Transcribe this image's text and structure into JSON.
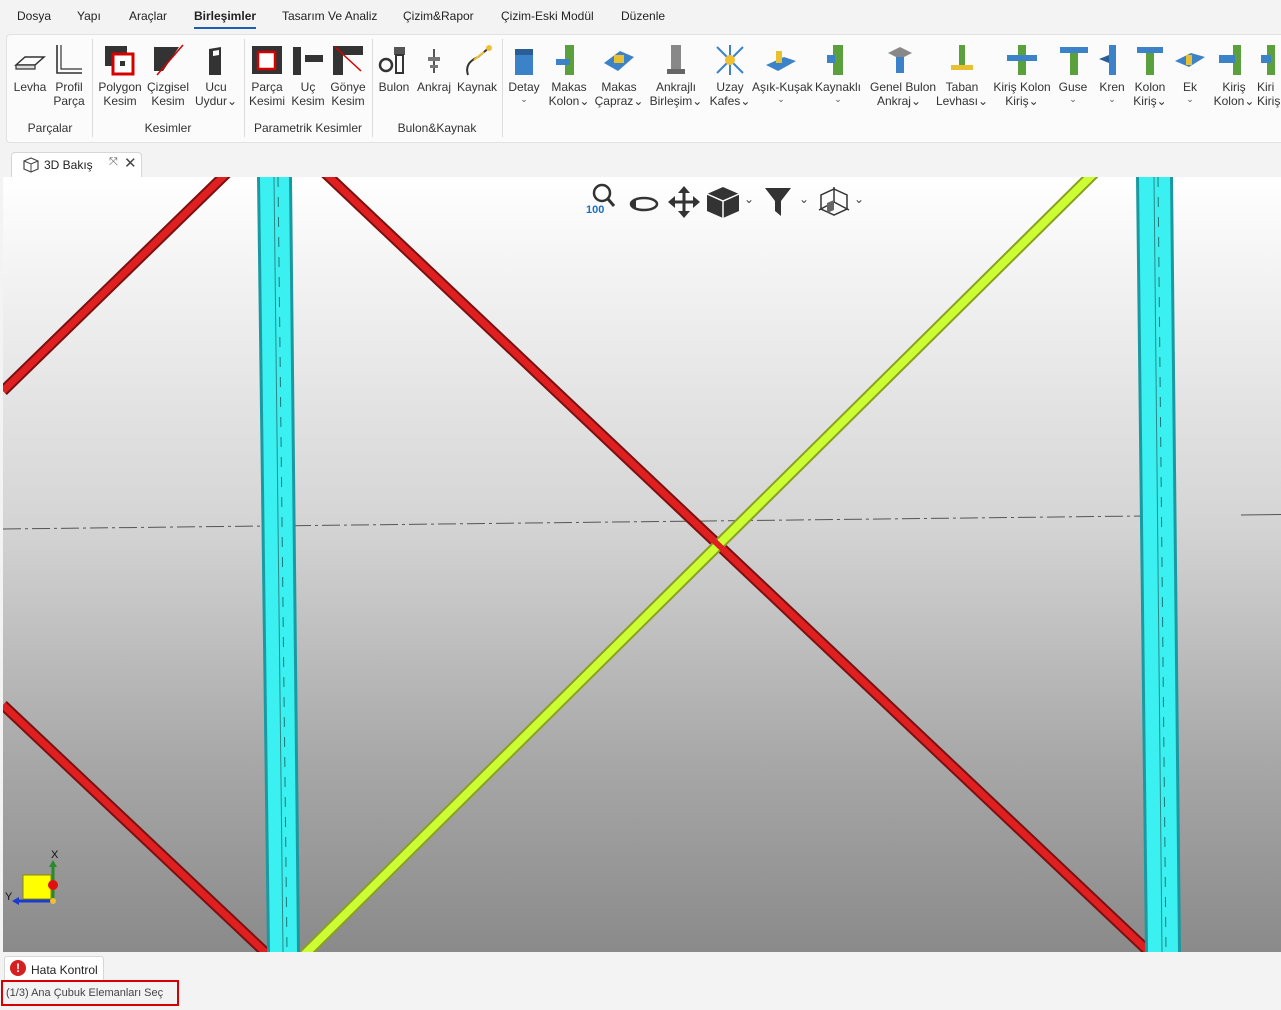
{
  "menu": {
    "items": [
      "Dosya",
      "Yapı",
      "Araçlar",
      "Birleşimler",
      "Tasarım Ve Analiz",
      "Çizim&Rapor",
      "Çizim-Eski Modül",
      "Düzenle"
    ],
    "active": "Birleşimler"
  },
  "ribbon": {
    "groups": {
      "parcalar": "Parçalar",
      "kesimler": "Kesimler",
      "parametrik": "Parametrik Kesimler",
      "bulon_kaynak": "Bulon&Kaynak"
    },
    "buttons": {
      "levha": [
        "Levha"
      ],
      "profil": [
        "Profil",
        "Parça"
      ],
      "polygon": [
        "Polygon",
        "Kesim"
      ],
      "cizgisel": [
        "Çizgisel",
        "Kesim"
      ],
      "ucu_uydur": [
        "Ucu",
        "Uydur"
      ],
      "parca_kesimi": [
        "Parça",
        "Kesimi"
      ],
      "uc_kesim": [
        "Uç",
        "Kesim"
      ],
      "gonye": [
        "Gönye",
        "Kesim"
      ],
      "bulon": [
        "Bulon"
      ],
      "ankraj": [
        "Ankraj"
      ],
      "kaynak": [
        "Kaynak"
      ],
      "detay": [
        "Detay"
      ],
      "makas_kolon": [
        "Makas",
        "Kolon"
      ],
      "makas_capraz": [
        "Makas",
        "Çapraz"
      ],
      "ankrajli": [
        "Ankrajlı",
        "Birleşim"
      ],
      "uzay": [
        "Uzay",
        "Kafes"
      ],
      "asik": [
        "Aşık-Kuşak"
      ],
      "kaynakli": [
        "Kaynaklı"
      ],
      "genel_bulon": [
        "Genel Bulon",
        "Ankraj"
      ],
      "taban": [
        "Taban",
        "Levhası"
      ],
      "kiris_kolon_kiris": [
        "Kiriş Kolon",
        "Kiriş"
      ],
      "guse": [
        "Guse"
      ],
      "kren": [
        "Kren"
      ],
      "kolon_kiris": [
        "Kolon",
        "Kiriş"
      ],
      "ek": [
        "Ek"
      ],
      "kiris_kolon": [
        "Kiriş",
        "Kolon"
      ],
      "kiris_cut": [
        "Kiri",
        "Kiriş"
      ]
    }
  },
  "view_tab": {
    "label": "3D Bakış"
  },
  "view_toolbar": {
    "zoom_level": "100"
  },
  "axis": {
    "x_label": "X",
    "y_label": "Y"
  },
  "error_panel": {
    "label": "Hata Kontrol"
  },
  "status": {
    "text": "(1/3) Ana Çubuk Elemanları Seç"
  },
  "colors": {
    "column": "#3af0f0",
    "brace_red": "#e02020",
    "brace_selected": "#ccff33",
    "connection_blue": "#3c82c8",
    "connection_green": "#5aa03c",
    "status_highlight": "#d60000"
  }
}
